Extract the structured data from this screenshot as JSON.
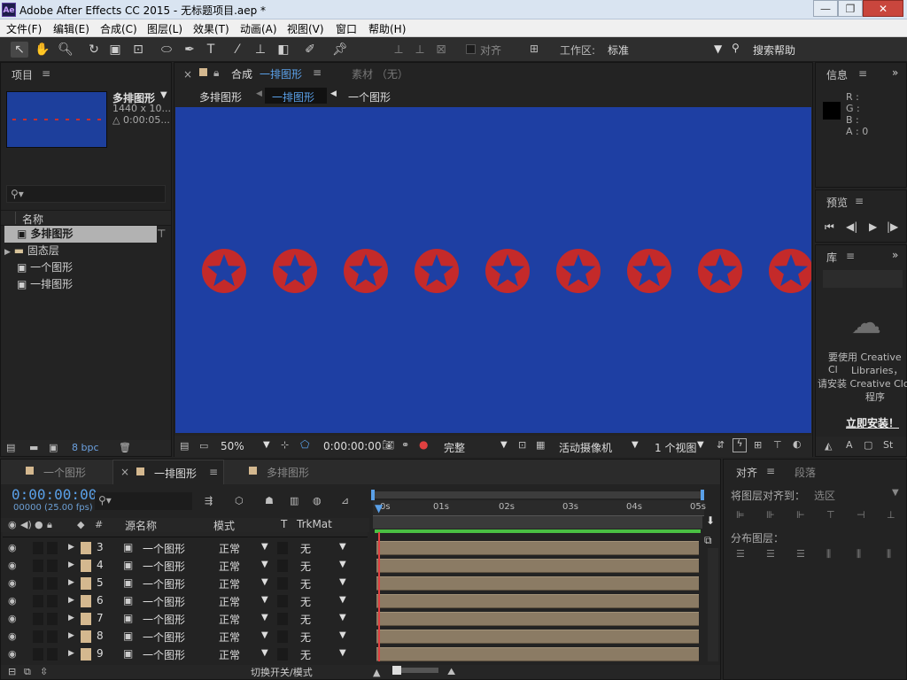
{
  "window": {
    "title": "Adobe After Effects CC 2015 - 无标题项目.aep *",
    "app_icon": "Ae"
  },
  "menu": [
    "文件(F)",
    "编辑(E)",
    "合成(C)",
    "图层(L)",
    "效果(T)",
    "动画(A)",
    "视图(V)",
    "窗口",
    "帮助(H)"
  ],
  "toolbar": {
    "snap_label": "对齐",
    "workspace_label": "工作区:",
    "workspace_value": "标准",
    "search_help": "搜索帮助"
  },
  "project": {
    "title": "项目",
    "selected_name": "多排图形",
    "selected_dims": "1440 x 10...",
    "selected_duration": "△ 0:00:05...",
    "column_name": "名称",
    "items": [
      {
        "name": "多排图形",
        "type": "comp"
      },
      {
        "name": "固态层",
        "type": "folder"
      },
      {
        "name": "一个图形",
        "type": "comp"
      },
      {
        "name": "一排图形",
        "type": "comp"
      }
    ],
    "bpc": "8 bpc"
  },
  "composition": {
    "tab_label": "合成",
    "tab_name": "一排图形",
    "footage_tab": "素材 （无）",
    "breadcrumbs": [
      "多排图形",
      "一排图形",
      "一个图形"
    ],
    "zoom": "50%",
    "timecode": "0:00:00:00",
    "resolution": "完整",
    "camera": "活动摄像机",
    "views": "1 个视图",
    "background_color": "#1e3fa3",
    "star_color": "#c42a2a",
    "star_count": 9
  },
  "info": {
    "title": "信息",
    "r": "R :",
    "g": "G :",
    "b": "B :",
    "a": "A : 0"
  },
  "preview": {
    "title": "预览"
  },
  "library": {
    "title": "库",
    "message": [
      "要使用 Creative Cl",
      "Libraries，",
      "请安装 Creative Clou",
      "程序"
    ],
    "install_link": "立即安装！"
  },
  "timeline": {
    "tabs": [
      "一个图形",
      "一排图形",
      "多排图形"
    ],
    "timecode": "0:00:00:00",
    "fps": "00000 (25.00 fps)",
    "columns": {
      "source": "源名称",
      "mode": "模式",
      "t": "T",
      "trkmat": "TrkMat"
    },
    "ruler": [
      "0s",
      "01s",
      "02s",
      "03s",
      "04s",
      "05s"
    ],
    "layers": [
      {
        "num": "3",
        "name": "一个图形",
        "mode": "正常",
        "trkmat": "无"
      },
      {
        "num": "4",
        "name": "一个图形",
        "mode": "正常",
        "trkmat": "无"
      },
      {
        "num": "5",
        "name": "一个图形",
        "mode": "正常",
        "trkmat": "无"
      },
      {
        "num": "6",
        "name": "一个图形",
        "mode": "正常",
        "trkmat": "无"
      },
      {
        "num": "7",
        "name": "一个图形",
        "mode": "正常",
        "trkmat": "无"
      },
      {
        "num": "8",
        "name": "一个图形",
        "mode": "正常",
        "trkmat": "无"
      },
      {
        "num": "9",
        "name": "一个图形",
        "mode": "正常",
        "trkmat": "无"
      }
    ],
    "toggle_label": "切换开关/模式"
  },
  "align": {
    "title": "对齐",
    "tab2": "段落",
    "align_to_label": "将图层对齐到：",
    "align_to_value": "选区",
    "distribute_label": "分布图层："
  }
}
